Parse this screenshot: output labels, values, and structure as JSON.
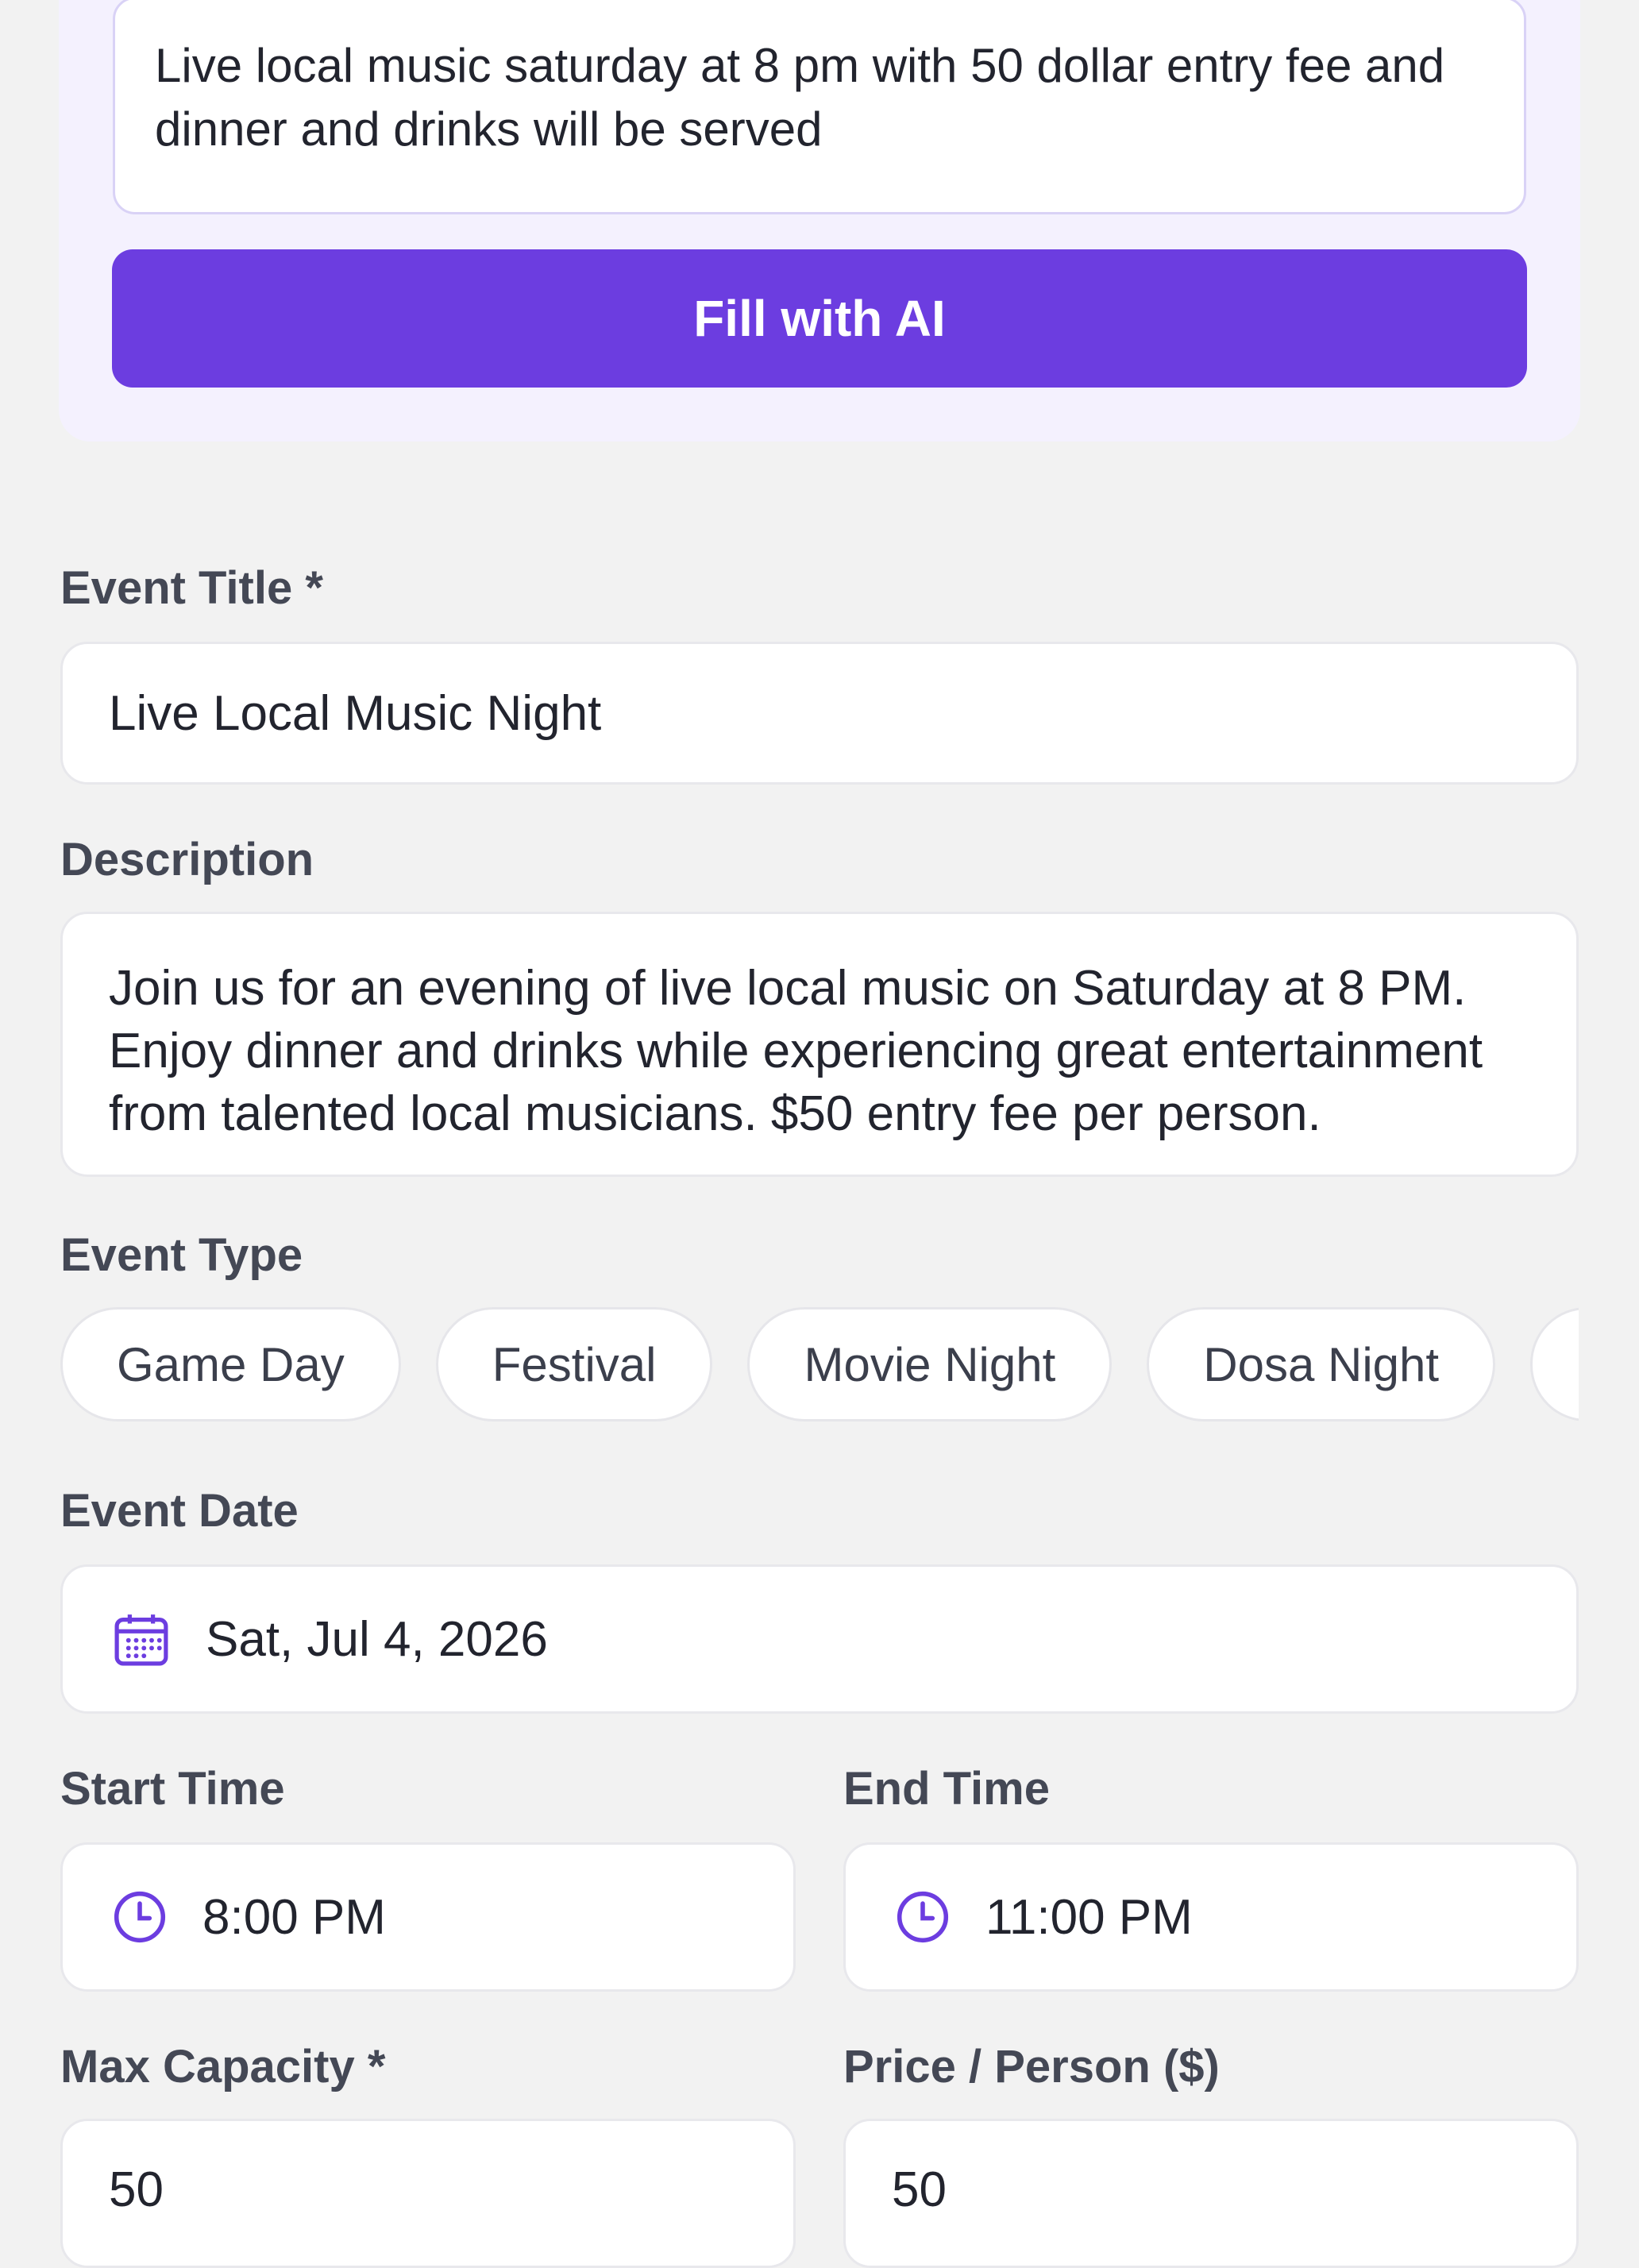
{
  "ai_assist": {
    "prompt_text": "Live local music saturday at 8 pm with 50 dollar entry fee and dinner and drinks will be served",
    "button_label": "Fill with AI"
  },
  "form": {
    "event_title": {
      "label": "Event Title *",
      "value": "Live Local Music Night"
    },
    "description": {
      "label": "Description",
      "value": "Join us for an evening of live local music on Saturday at 8 PM. Enjoy dinner and drinks while experiencing great entertainment from talented local musicians. $50 entry fee per person."
    },
    "event_type": {
      "label": "Event Type",
      "options": [
        "Game Day",
        "Festival",
        "Movie Night",
        "Dosa Night"
      ]
    },
    "event_date": {
      "label": "Event Date",
      "value": "Sat, Jul 4, 2026",
      "icon": "calendar-icon"
    },
    "start_time": {
      "label": "Start Time",
      "value": "8:00 PM",
      "icon": "clock-icon"
    },
    "end_time": {
      "label": "End Time",
      "value": "11:00 PM",
      "icon": "clock-icon"
    },
    "max_capacity": {
      "label": "Max Capacity *",
      "value": "50"
    },
    "price_per_person": {
      "label": "Price / Person ($)",
      "value": "50"
    }
  },
  "colors": {
    "accent": "#6c3de0",
    "panel_background": "#f4f1fe",
    "page_background": "#f2f2f2"
  }
}
